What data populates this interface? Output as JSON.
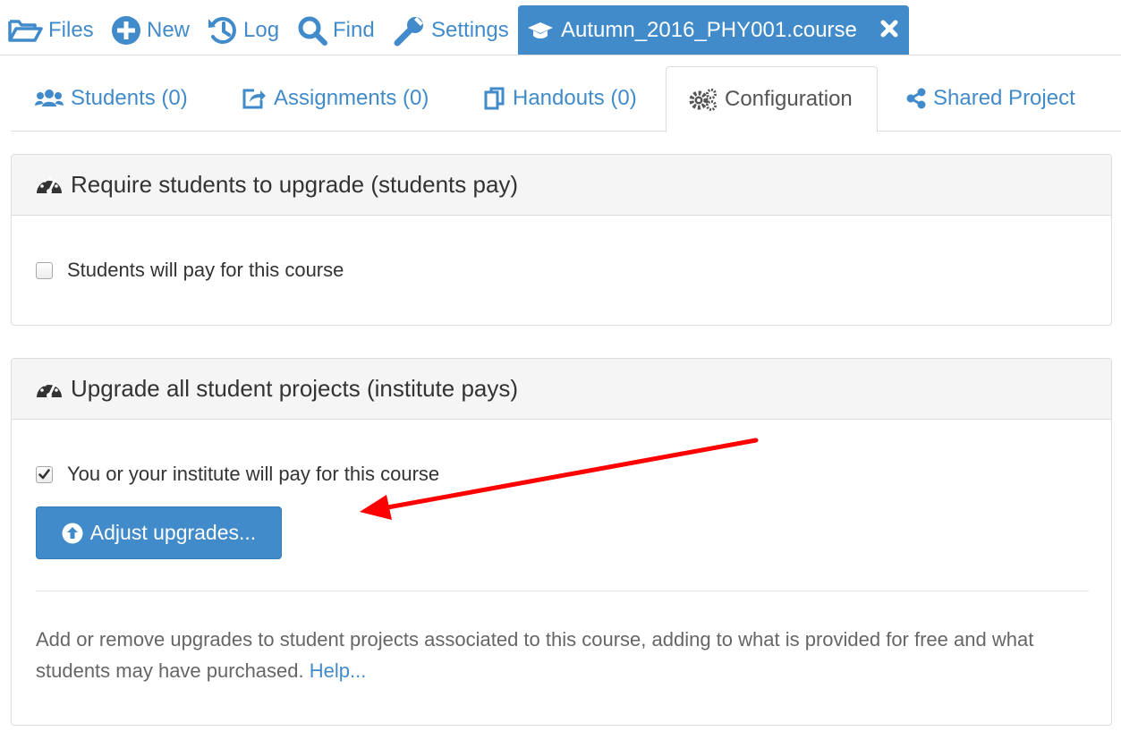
{
  "toolbar": {
    "files_label": "Files",
    "new_label": "New",
    "log_label": "Log",
    "find_label": "Find",
    "settings_label": "Settings",
    "course_tab_label": "Autumn_2016_PHY001.course"
  },
  "tabs": {
    "students": "Students (0)",
    "assignments": "Assignments (0)",
    "handouts": "Handouts (0)",
    "configuration": "Configuration",
    "shared_project": "Shared Project"
  },
  "panel_students_pay": {
    "title": "Require students to upgrade (students pay)",
    "checkbox_label": "Students will pay for this course",
    "checked": false
  },
  "panel_institute_pays": {
    "title": "Upgrade all student projects (institute pays)",
    "checkbox_label": "You or your institute will pay for this course",
    "checked": true,
    "button_label": "Adjust upgrades...",
    "help_text": "Add or remove upgrades to student projects associated to this course, adding to what is provided for free and what students may have purchased.",
    "help_link": "Help..."
  },
  "icons": {
    "files": "folder-open-icon",
    "new": "plus-circle-icon",
    "log": "history-icon",
    "find": "search-icon",
    "settings": "wrench-icon",
    "course": "graduation-cap-icon",
    "close": "close-icon",
    "students": "users-icon",
    "assignments": "share-square-icon",
    "handouts": "copy-icon",
    "configuration": "cogs-icon",
    "shared_project": "share-alt-icon",
    "panel": "dashboard-icon",
    "upgrade_button": "arrow-circle-up-icon"
  },
  "colors": {
    "accent": "#428bca",
    "annotation_arrow": "#ff0000"
  }
}
